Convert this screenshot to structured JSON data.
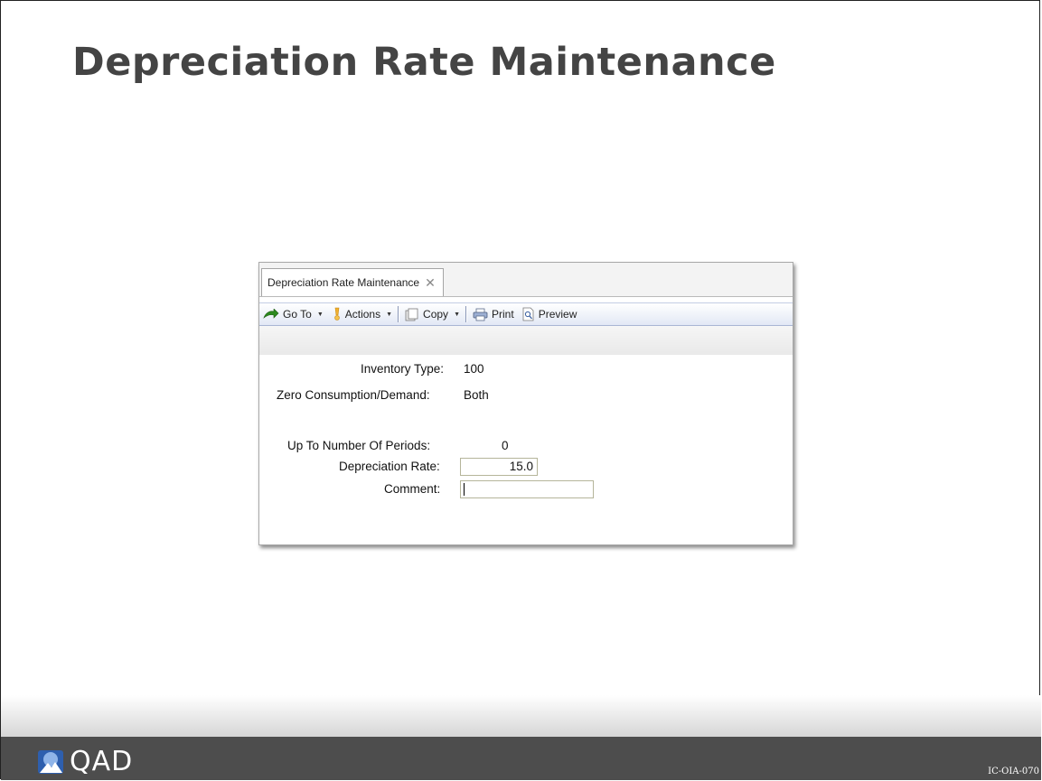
{
  "slide": {
    "title": "Depreciation Rate Maintenance",
    "doc_code": "IC-OIA-070"
  },
  "window": {
    "tab": {
      "label": "Depreciation Rate Maintenance",
      "close_icon": "close-icon"
    },
    "toolbar": {
      "goto": {
        "label": "Go To",
        "icon": "go-to-arrow-icon"
      },
      "actions": {
        "label": "Actions",
        "icon": "actions-icon"
      },
      "copy": {
        "label": "Copy",
        "icon": "copy-icon"
      },
      "print": {
        "label": "Print",
        "icon": "printer-icon"
      },
      "preview": {
        "label": "Preview",
        "icon": "preview-icon"
      }
    },
    "form": {
      "inventory_type": {
        "label": "Inventory Type:",
        "value": "100"
      },
      "zero_consumption": {
        "label": "Zero Consumption/Demand:",
        "value": "Both"
      },
      "up_to_periods": {
        "label": "Up To Number Of Periods:",
        "value": "0"
      },
      "depreciation_rate": {
        "label": "Depreciation Rate:",
        "value": "15.0"
      },
      "comment": {
        "label": "Comment:",
        "value": ""
      }
    }
  },
  "footer": {
    "logo_text": "QAD"
  }
}
